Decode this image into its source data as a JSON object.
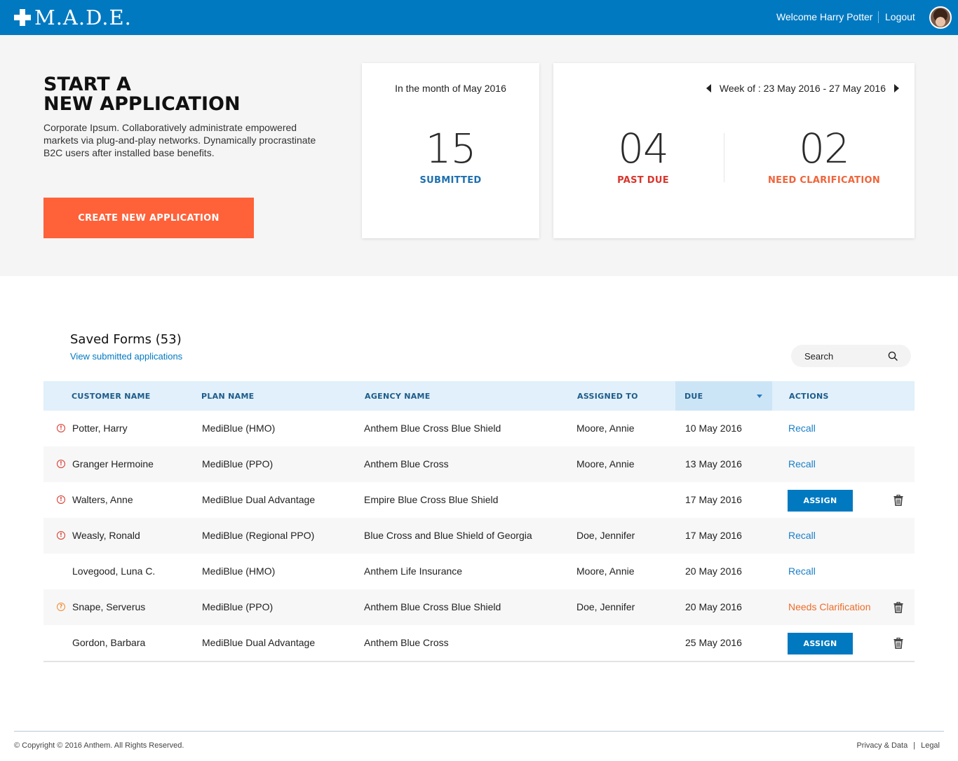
{
  "header": {
    "logo_text": "M.A.D.E.",
    "welcome": "Welcome Harry Potter",
    "logout": "Logout"
  },
  "hero": {
    "title_line1": "START A",
    "title_line2": "NEW APPLICATION",
    "description": "Corporate Ipsum. Collaboratively administrate empowered markets via plug-and-play networks. Dynamically procrastinate B2C users after installed base benefits.",
    "create_button": "CREATE NEW APPLICATION"
  },
  "month_card": {
    "caption": "In the month of May 2016",
    "count": "15",
    "label": "SUBMITTED"
  },
  "week_card": {
    "caption": "Week of : 23 May 2016 - 27 May 2016",
    "past_due_count": "04",
    "past_due_label": "PAST DUE",
    "clarification_count": "02",
    "clarification_label": "NEED CLARIFICATION"
  },
  "saved": {
    "title": "Saved Forms (53)",
    "link": "View submitted applications",
    "search_placeholder": "Search"
  },
  "table": {
    "headers": [
      "CUSTOMER NAME",
      "PLAN NAME",
      "AGENCY NAME",
      "ASSIGNED TO",
      "DUE",
      "ACTIONS"
    ],
    "rows": [
      {
        "status": "warning",
        "customer": "Potter, Harry",
        "plan": "MediBlue (HMO)",
        "agency": "Anthem Blue Cross Blue Shield",
        "assigned": "Moore, Annie",
        "due": "10 May 2016",
        "action": "Recall",
        "action_type": "link",
        "delete": false
      },
      {
        "status": "warning",
        "customer": "Granger Hermoine",
        "plan": "MediBlue (PPO)",
        "agency": "Anthem Blue Cross",
        "assigned": "Moore, Annie",
        "due": "13 May 2016",
        "action": "Recall",
        "action_type": "link",
        "delete": false
      },
      {
        "status": "warning",
        "customer": "Walters, Anne",
        "plan": "MediBlue Dual Advantage",
        "agency": "Empire Blue Cross Blue Shield",
        "assigned": "",
        "due": "17 May 2016",
        "action": "ASSIGN",
        "action_type": "button",
        "delete": true
      },
      {
        "status": "warning",
        "customer": "Weasly, Ronald",
        "plan": "MediBlue (Regional PPO)",
        "agency": "Blue Cross and Blue Shield of Georgia",
        "assigned": "Doe, Jennifer",
        "due": "17 May 2016",
        "action": "Recall",
        "action_type": "link",
        "delete": false
      },
      {
        "status": "none",
        "customer": "Lovegood, Luna C.",
        "plan": "MediBlue (HMO)",
        "agency": "Anthem Life Insurance",
        "assigned": "Moore, Annie",
        "due": "20 May 2016",
        "action": "Recall",
        "action_type": "link",
        "delete": false
      },
      {
        "status": "help",
        "customer": "Snape, Serverus",
        "plan": "MediBlue (PPO)",
        "agency": "Anthem Blue Cross Blue Shield",
        "assigned": "Doe, Jennifer",
        "due": "20 May 2016",
        "action": "Needs Clarification",
        "action_type": "needs",
        "delete": true
      },
      {
        "status": "none",
        "customer": "Gordon, Barbara",
        "plan": "MediBlue Dual Advantage",
        "agency": "Anthem Blue Cross",
        "assigned": "",
        "due": "25 May 2016",
        "action": "ASSIGN",
        "action_type": "button",
        "delete": true
      }
    ]
  },
  "footer": {
    "copyright": "© Copyright © 2016 Anthem. All Rights Reserved.",
    "privacy": "Privacy & Data",
    "separator": "|",
    "legal": "Legal"
  },
  "colors": {
    "brand_blue": "#0079c1",
    "cta_orange": "#ff6139",
    "past_due_red": "#d9352b",
    "clarification_orange": "#f0643a"
  },
  "icons": {
    "logo": "medical-cross-icon",
    "search": "search-icon",
    "delete": "trash-icon",
    "warning": "alert-circle-icon",
    "help": "question-circle-icon",
    "week_prev": "caret-left-icon",
    "week_next": "caret-right-icon",
    "sort": "sort-down-icon"
  }
}
